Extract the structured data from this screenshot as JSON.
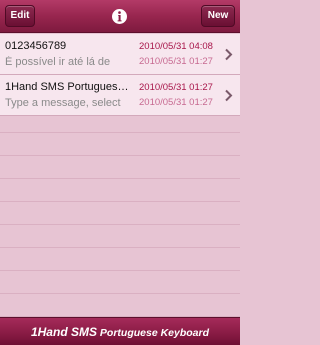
{
  "navbar": {
    "edit_label": "Edit",
    "new_label": "New",
    "info_icon": "info-icon"
  },
  "messages": [
    {
      "name": "0123456789",
      "preview": "É possível ir até lá de",
      "date1": "2010/05/31 04:08",
      "date2": "2010/05/31 01:27"
    },
    {
      "name": "1Hand SMS Portugues…",
      "preview": "Type a message, select",
      "date1": "2010/05/31 01:27",
      "date2": "2010/05/31 01:27"
    }
  ],
  "footer": {
    "title_prefix": "1Hand SMS",
    "title_suffix": "Portuguese Keyboard"
  },
  "colors": {
    "accent": "#98264f",
    "background": "#e7c4d3",
    "date_primary": "#a8164a",
    "date_secondary": "#c76a91"
  }
}
